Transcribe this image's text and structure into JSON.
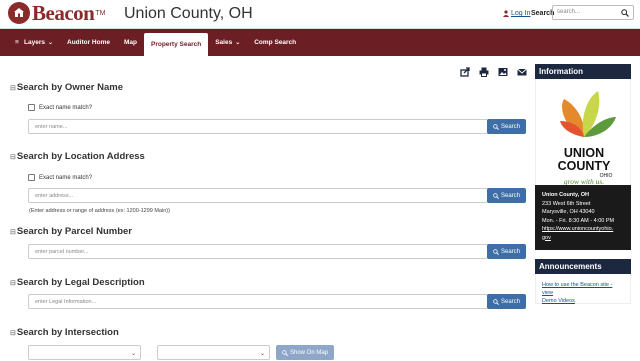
{
  "header": {
    "brand": "Beacon",
    "trademark": "TM",
    "county": "Union County, OH",
    "login": "Log In",
    "search_label": "Search",
    "search_placeholder": "search..."
  },
  "nav": {
    "items": [
      {
        "label": "Layers",
        "has_caret": true,
        "hamburger": true
      },
      {
        "label": "Auditor Home"
      },
      {
        "label": "Map"
      },
      {
        "label": "Property Search",
        "active": true
      },
      {
        "label": "Sales",
        "has_caret": true
      },
      {
        "label": "Comp Search"
      }
    ]
  },
  "owner": {
    "title": "Search by Owner Name",
    "exact_label": "Exact name match?",
    "placeholder": "enter name...",
    "button": "Search"
  },
  "location": {
    "title": "Search by Location Address",
    "exact_label": "Exact name match?",
    "placeholder": "enter address...",
    "button": "Search",
    "hint": "(Enter address or range of address (ex: 1200-1299 Main))"
  },
  "parcel": {
    "title": "Search by Parcel Number",
    "placeholder": "enter parcel number...",
    "button": "Search"
  },
  "legal": {
    "title": "Search by Legal Description",
    "placeholder": "enter Legal Information...",
    "button": "Search"
  },
  "intersection": {
    "title": "Search by Intersection",
    "button": "Show On Map"
  },
  "info": {
    "title": "Information",
    "logo_line1": "UNION",
    "logo_line2": "COUNTY",
    "logo_line3": "OHIO",
    "tagline": "grow with us.",
    "address_name": "Union County, OH",
    "address_street": "233 West 6th Street",
    "address_city": "Marysville, OH 43040",
    "hours": "Mon. - Fri. 8:30 AM - 4:00 PM",
    "url_line1": "https://www.unioncountyohio.",
    "url_line2": "gov"
  },
  "announcements": {
    "title": "Announcements",
    "link_line1": "How to use the Beacon site - view",
    "link_line2": "Demo Videos"
  },
  "colors": {
    "nav": "#6b1e23",
    "brand": "#8b2a2a",
    "button": "#3e6ea6",
    "sidebar_head": "#1c2840"
  }
}
